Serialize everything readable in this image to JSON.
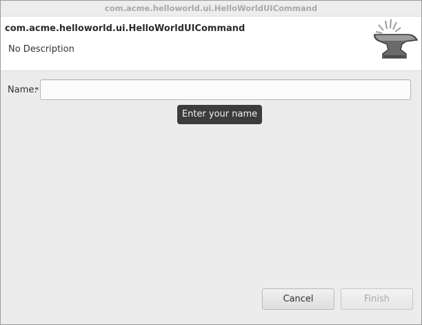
{
  "window": {
    "title": "com.acme.helloworld.ui.HelloWorldUICommand"
  },
  "banner": {
    "title": "com.acme.helloworld.ui.HelloWorldUICommand",
    "description": "No Description",
    "icon": "anvil-icon"
  },
  "form": {
    "name_label": "Name:",
    "required_mark": "*",
    "name_value": "",
    "name_tooltip": "Enter your name"
  },
  "buttons": {
    "cancel_label": "Cancel",
    "finish_label": "Finish"
  }
}
